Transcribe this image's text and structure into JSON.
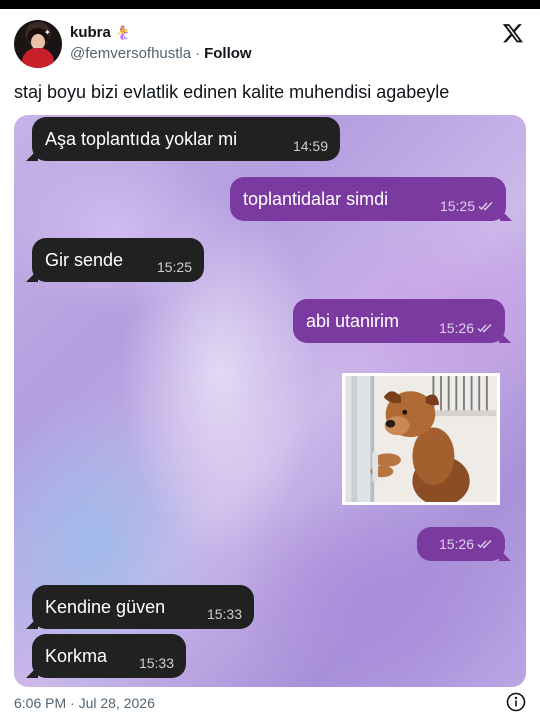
{
  "tweet": {
    "display_name": "kubra",
    "name_emoji": "🧜‍♀️",
    "handle": "@femversofhustla",
    "separator": "·",
    "follow_label": "Follow",
    "text": "staj boyu bizi evlatlik edinen kalite muhendisi agabeyle",
    "timestamp": "6:06 PM · Jul 28, 2026",
    "icons": {
      "brand": "x-logo-icon",
      "info": "info-icon",
      "avatar": "profile-avatar"
    }
  },
  "chat": {
    "colors": {
      "incoming": "#212121",
      "outgoing": "#7b3aa0",
      "background": "#b9a5e4"
    },
    "messages": [
      {
        "direction": "in",
        "text": "Aşa toplantıda yoklar mi",
        "time": "14:59"
      },
      {
        "direction": "out",
        "text": "toplantidalar simdi",
        "time": "15:25",
        "read": true
      },
      {
        "direction": "in",
        "text": "Gir sende",
        "time": "15:25"
      },
      {
        "direction": "out",
        "text": "abi utanirim",
        "time": "15:26",
        "read": true
      },
      {
        "direction": "out",
        "sticker": "shy-dog-peeking-sticker",
        "time": "15:26",
        "read": true
      },
      {
        "direction": "in",
        "text": "Kendine güven",
        "time": "15:33"
      },
      {
        "direction": "in",
        "text": "Korkma",
        "time": "15:33"
      }
    ]
  }
}
